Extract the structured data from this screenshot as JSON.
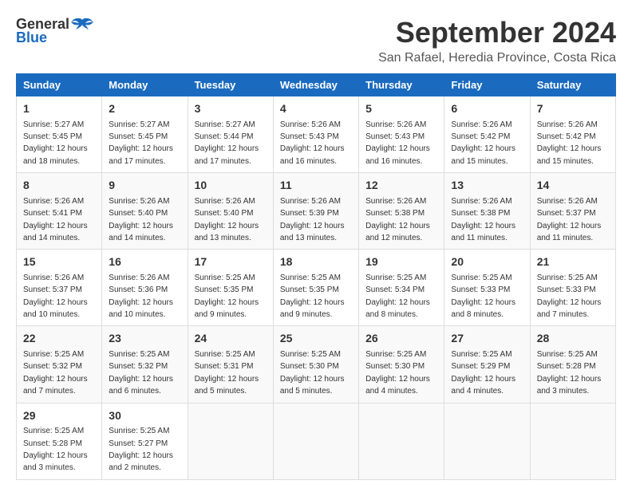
{
  "header": {
    "logo_general": "General",
    "logo_blue": "Blue",
    "title": "September 2024",
    "subtitle": "San Rafael, Heredia Province, Costa Rica"
  },
  "calendar": {
    "days_of_week": [
      "Sunday",
      "Monday",
      "Tuesday",
      "Wednesday",
      "Thursday",
      "Friday",
      "Saturday"
    ],
    "weeks": [
      [
        null,
        {
          "day": 2,
          "sunrise": "5:27 AM",
          "sunset": "5:45 PM",
          "daylight": "12 hours and 17 minutes."
        },
        {
          "day": 3,
          "sunrise": "5:27 AM",
          "sunset": "5:44 PM",
          "daylight": "12 hours and 17 minutes."
        },
        {
          "day": 4,
          "sunrise": "5:26 AM",
          "sunset": "5:43 PM",
          "daylight": "12 hours and 16 minutes."
        },
        {
          "day": 5,
          "sunrise": "5:26 AM",
          "sunset": "5:43 PM",
          "daylight": "12 hours and 16 minutes."
        },
        {
          "day": 6,
          "sunrise": "5:26 AM",
          "sunset": "5:42 PM",
          "daylight": "12 hours and 15 minutes."
        },
        {
          "day": 7,
          "sunrise": "5:26 AM",
          "sunset": "5:42 PM",
          "daylight": "12 hours and 15 minutes."
        }
      ],
      [
        {
          "day": 1,
          "sunrise": "5:27 AM",
          "sunset": "5:45 PM",
          "daylight": "12 hours and 18 minutes."
        },
        {
          "day": 8,
          "sunrise": "5:26 AM",
          "sunset": "5:41 PM",
          "daylight": "12 hours and 14 minutes."
        },
        {
          "day": 9,
          "sunrise": "5:26 AM",
          "sunset": "5:40 PM",
          "daylight": "12 hours and 14 minutes."
        },
        {
          "day": 10,
          "sunrise": "5:26 AM",
          "sunset": "5:40 PM",
          "daylight": "12 hours and 13 minutes."
        },
        {
          "day": 11,
          "sunrise": "5:26 AM",
          "sunset": "5:39 PM",
          "daylight": "12 hours and 13 minutes."
        },
        {
          "day": 12,
          "sunrise": "5:26 AM",
          "sunset": "5:38 PM",
          "daylight": "12 hours and 12 minutes."
        },
        {
          "day": 13,
          "sunrise": "5:26 AM",
          "sunset": "5:38 PM",
          "daylight": "12 hours and 11 minutes."
        },
        {
          "day": 14,
          "sunrise": "5:26 AM",
          "sunset": "5:37 PM",
          "daylight": "12 hours and 11 minutes."
        }
      ],
      [
        {
          "day": 15,
          "sunrise": "5:26 AM",
          "sunset": "5:37 PM",
          "daylight": "12 hours and 10 minutes."
        },
        {
          "day": 16,
          "sunrise": "5:26 AM",
          "sunset": "5:36 PM",
          "daylight": "12 hours and 10 minutes."
        },
        {
          "day": 17,
          "sunrise": "5:25 AM",
          "sunset": "5:35 PM",
          "daylight": "12 hours and 9 minutes."
        },
        {
          "day": 18,
          "sunrise": "5:25 AM",
          "sunset": "5:35 PM",
          "daylight": "12 hours and 9 minutes."
        },
        {
          "day": 19,
          "sunrise": "5:25 AM",
          "sunset": "5:34 PM",
          "daylight": "12 hours and 8 minutes."
        },
        {
          "day": 20,
          "sunrise": "5:25 AM",
          "sunset": "5:33 PM",
          "daylight": "12 hours and 8 minutes."
        },
        {
          "day": 21,
          "sunrise": "5:25 AM",
          "sunset": "5:33 PM",
          "daylight": "12 hours and 7 minutes."
        }
      ],
      [
        {
          "day": 22,
          "sunrise": "5:25 AM",
          "sunset": "5:32 PM",
          "daylight": "12 hours and 7 minutes."
        },
        {
          "day": 23,
          "sunrise": "5:25 AM",
          "sunset": "5:32 PM",
          "daylight": "12 hours and 6 minutes."
        },
        {
          "day": 24,
          "sunrise": "5:25 AM",
          "sunset": "5:31 PM",
          "daylight": "12 hours and 5 minutes."
        },
        {
          "day": 25,
          "sunrise": "5:25 AM",
          "sunset": "5:30 PM",
          "daylight": "12 hours and 5 minutes."
        },
        {
          "day": 26,
          "sunrise": "5:25 AM",
          "sunset": "5:30 PM",
          "daylight": "12 hours and 4 minutes."
        },
        {
          "day": 27,
          "sunrise": "5:25 AM",
          "sunset": "5:29 PM",
          "daylight": "12 hours and 4 minutes."
        },
        {
          "day": 28,
          "sunrise": "5:25 AM",
          "sunset": "5:28 PM",
          "daylight": "12 hours and 3 minutes."
        }
      ],
      [
        {
          "day": 29,
          "sunrise": "5:25 AM",
          "sunset": "5:28 PM",
          "daylight": "12 hours and 3 minutes."
        },
        {
          "day": 30,
          "sunrise": "5:25 AM",
          "sunset": "5:27 PM",
          "daylight": "12 hours and 2 minutes."
        },
        null,
        null,
        null,
        null,
        null
      ]
    ]
  }
}
